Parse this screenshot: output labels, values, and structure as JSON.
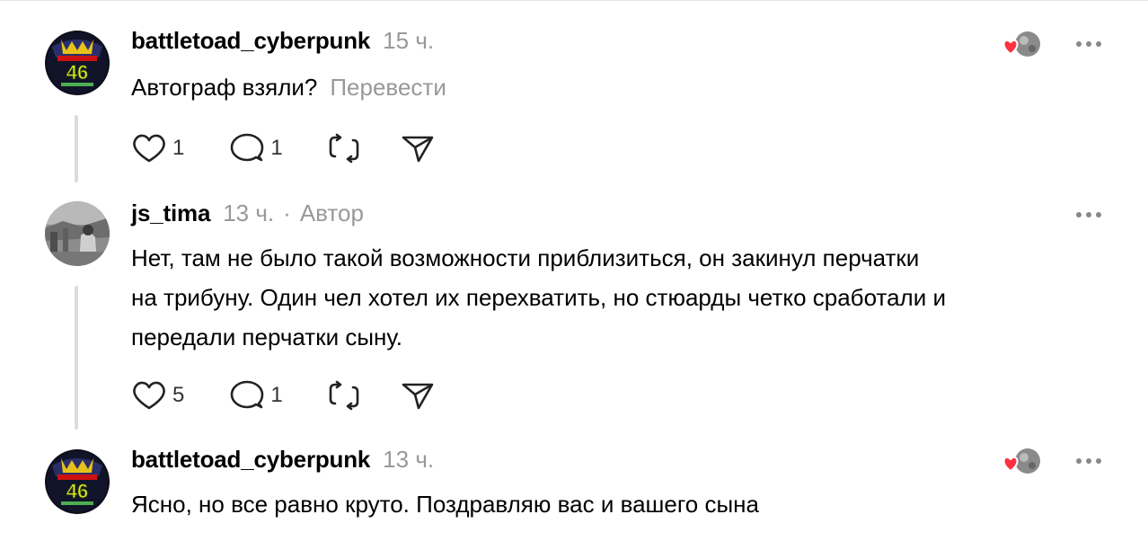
{
  "comments": [
    {
      "username": "battletoad_cyberpunk",
      "time": "15 ч.",
      "text": "Автограф взяли?",
      "translate": "Перевести",
      "likes": "1",
      "replies": "1"
    },
    {
      "username": "js_tima",
      "time": "13 ч.",
      "separator": "·",
      "badge": "Автор",
      "text_lines": [
        "Нет, там не было такой возможности приблизиться, он закинул перчатки",
        "на трибуну. Один чел хотел их перехватить, но стюарды четко сработали и",
        "передали перчатки сыну."
      ],
      "likes": "5",
      "replies": "1"
    },
    {
      "username": "battletoad_cyberpunk",
      "time": "13 ч.",
      "text": "Ясно, но все равно круто. Поздравляю вас и вашего сына"
    }
  ],
  "avatar_badge_number": "46",
  "colors": {
    "heart": "#ff3040",
    "meta": "#999999",
    "thread": "#dcdcdc"
  }
}
